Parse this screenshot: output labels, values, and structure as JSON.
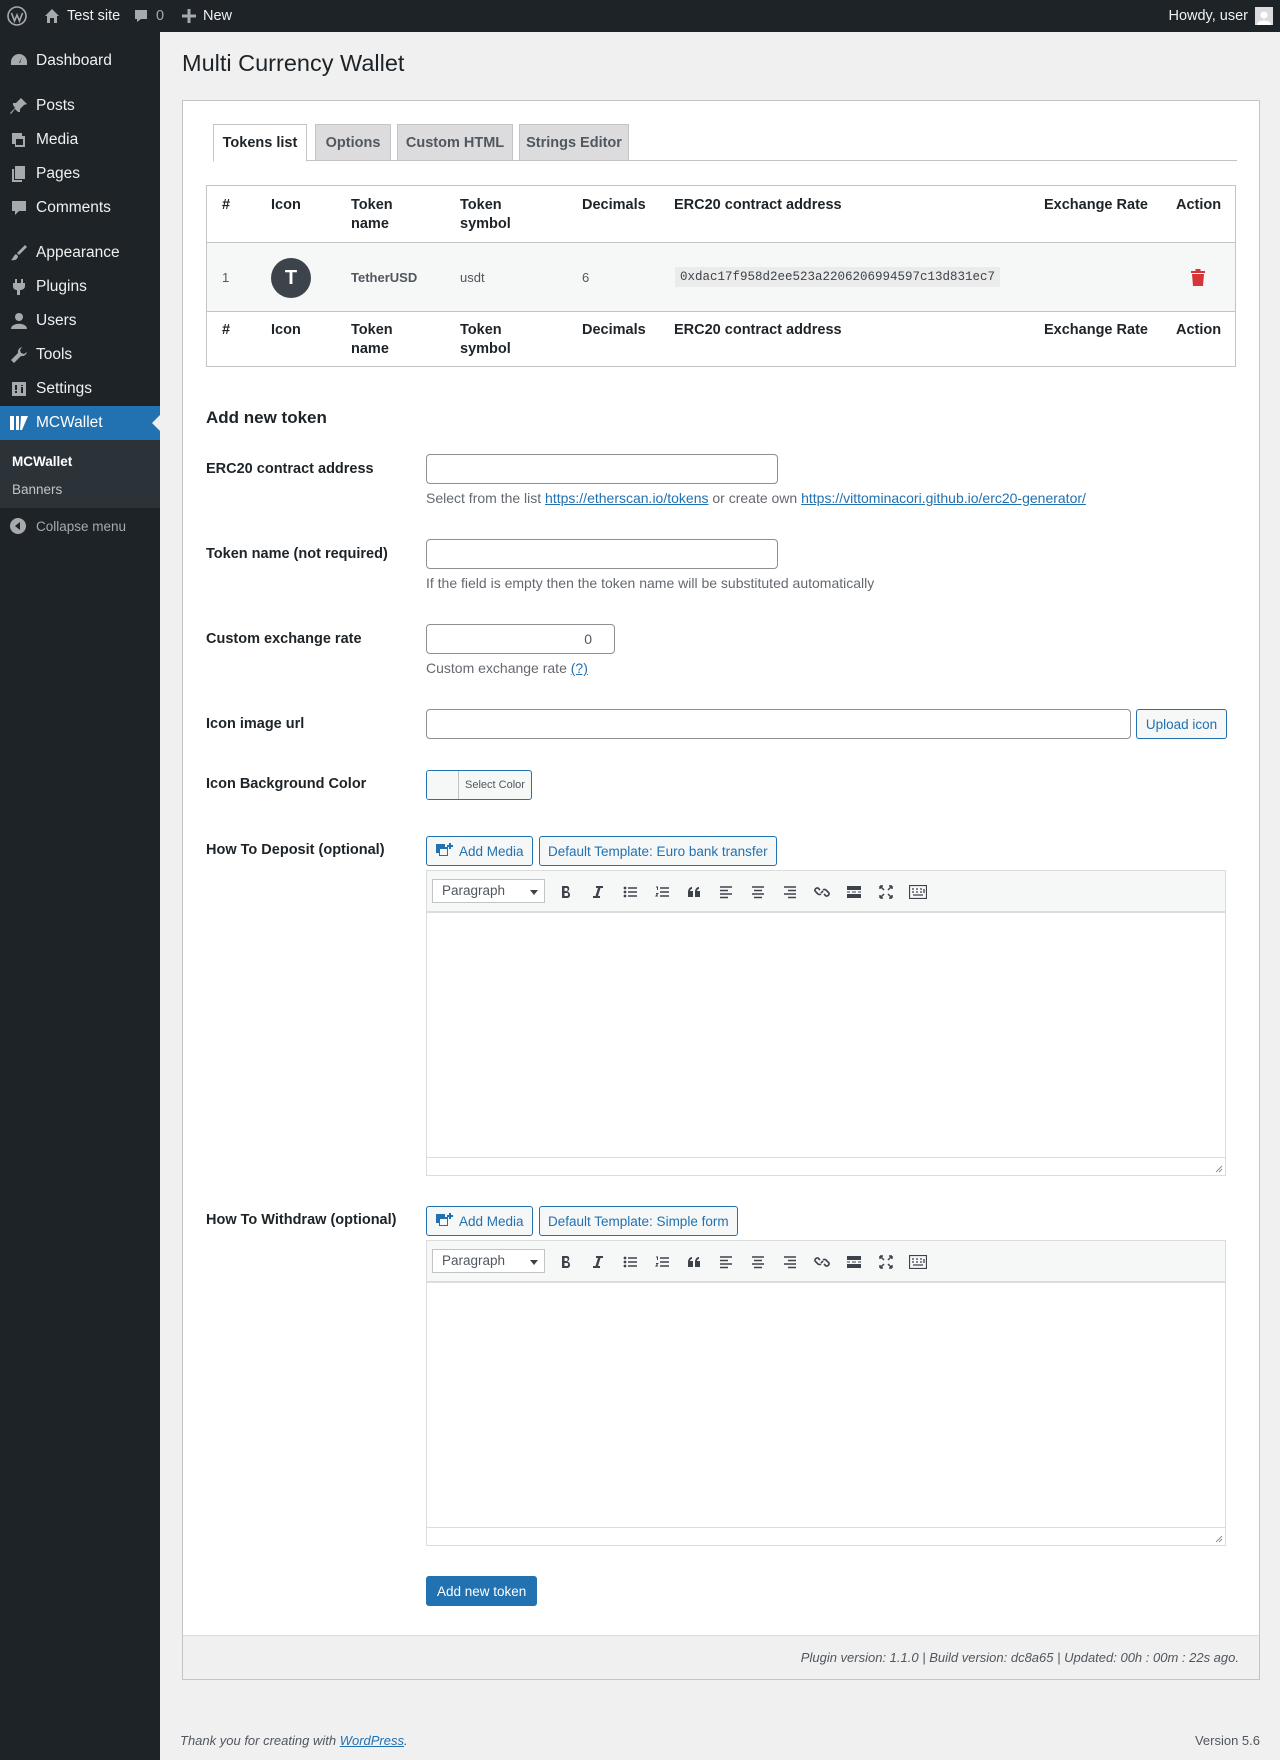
{
  "admin_bar": {
    "site_name": "Test site",
    "comments_count": "0",
    "new_label": "New",
    "howdy": "Howdy, user"
  },
  "sidebar": {
    "items": [
      {
        "label": "Dashboard",
        "icon": "dashboard-icon"
      },
      {
        "label": "Posts",
        "icon": "pin-icon"
      },
      {
        "label": "Media",
        "icon": "media-icon"
      },
      {
        "label": "Pages",
        "icon": "pages-icon"
      },
      {
        "label": "Comments",
        "icon": "comment-icon"
      },
      {
        "label": "Appearance",
        "icon": "brush-icon"
      },
      {
        "label": "Plugins",
        "icon": "plugin-icon"
      },
      {
        "label": "Users",
        "icon": "user-icon"
      },
      {
        "label": "Tools",
        "icon": "wrench-icon"
      },
      {
        "label": "Settings",
        "icon": "settings-icon"
      },
      {
        "label": "MCWallet",
        "icon": "mcwallet-icon"
      }
    ],
    "submenu": [
      "MCWallet",
      "Banners"
    ],
    "collapse_label": "Collapse menu"
  },
  "page": {
    "title": "Multi Currency Wallet"
  },
  "tabs": [
    "Tokens list",
    "Options",
    "Custom HTML",
    "Strings Editor"
  ],
  "tokens_table": {
    "headers": [
      "#",
      "Icon",
      "Token name",
      "Token symbol",
      "Decimals",
      "ERC20 contract address",
      "Exchange Rate",
      "Action"
    ],
    "rows": [
      {
        "num": "1",
        "icon_letter": "T",
        "name": "TetherUSD",
        "symbol": "usdt",
        "decimals": "6",
        "address": "0xdac17f958d2ee523a2206206994597c13d831ec7",
        "rate": ""
      }
    ]
  },
  "form": {
    "heading": "Add new token",
    "erc20_label": "ERC20 contract address",
    "erc20_value": "",
    "erc20_desc_prefix": "Select from the list ",
    "erc20_link1": "https://etherscan.io/tokens",
    "erc20_desc_middle": " or create own ",
    "erc20_link2": "https://vittominacori.github.io/erc20-generator/",
    "name_label": "Token name (not required)",
    "name_value": "",
    "name_desc": "If the field is empty then the token name will be substituted automatically",
    "rate_label": "Custom exchange rate",
    "rate_value": "0",
    "rate_desc": "Custom exchange rate ",
    "rate_help": "(?)",
    "icon_label": "Icon image url",
    "icon_value": "",
    "upload_button": "Upload icon",
    "bg_label": "Icon Background Color",
    "select_color": "Select Color",
    "deposit_label": "How To Deposit (optional)",
    "deposit_template": "Default Template: Euro bank transfer",
    "withdraw_label": "How To Withdraw (optional)",
    "withdraw_template": "Default Template: Simple form",
    "add_media": "Add Media",
    "paragraph": "Paragraph",
    "submit": "Add new token"
  },
  "plugin_footer": "Plugin version: 1.1.0 | Build version: dc8a65 | Updated: 00h : 00m : 22s ago.",
  "footer": {
    "thanks_prefix": "Thank you for creating with ",
    "wordpress_link": "WordPress",
    "thanks_suffix": ".",
    "version": "Version 5.6"
  },
  "colors": {
    "admin_bg": "#1d2327",
    "accent": "#2271b1",
    "danger": "#d63638"
  }
}
